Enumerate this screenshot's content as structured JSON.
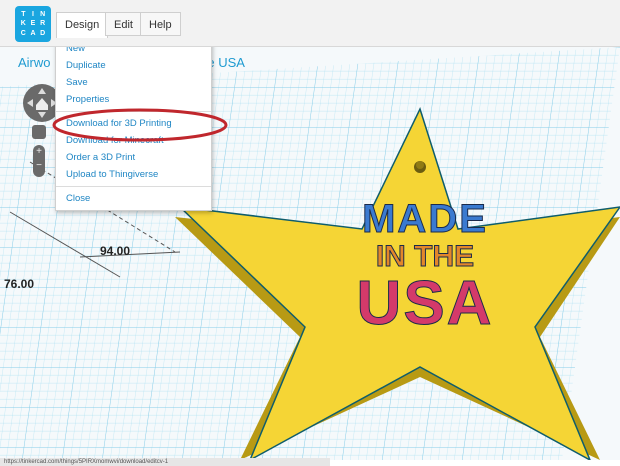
{
  "app": {
    "logo_letters": [
      "T",
      "I",
      "N",
      "K",
      "E",
      "R",
      "C",
      "A",
      "D"
    ],
    "title": "Airwolf3D Made in the USA",
    "title_visible_left": "Airwo",
    "title_visible_right": "the USA"
  },
  "menubar": {
    "items": [
      {
        "label": "Design",
        "name": "menu-design"
      },
      {
        "label": "Edit",
        "name": "menu-edit"
      },
      {
        "label": "Help",
        "name": "menu-help"
      }
    ]
  },
  "dropdown": {
    "group1": [
      "New",
      "Duplicate",
      "Save",
      "Properties"
    ],
    "group2": [
      "Download for 3D Printing",
      "Download for Minecraft",
      "Order a 3D Print",
      "Upload to Thingiverse"
    ],
    "group3": [
      "Close"
    ],
    "highlighted": "Download for 3D Printing"
  },
  "canvas": {
    "dimension_width": "94.00",
    "dimension_height": "76.00",
    "design_text_line1": "MADE",
    "design_text_line2": "IN THE",
    "design_text_line3": "USA"
  },
  "statusbar": {
    "url": "https://tinkercad.com/things/5PIRXmomwvi/download/editcv-1"
  },
  "colors": {
    "accent": "#1f9bd1",
    "grid_bg": "#cfeefa",
    "star": "#f5d535",
    "highlight_circle": "#c0272d"
  }
}
